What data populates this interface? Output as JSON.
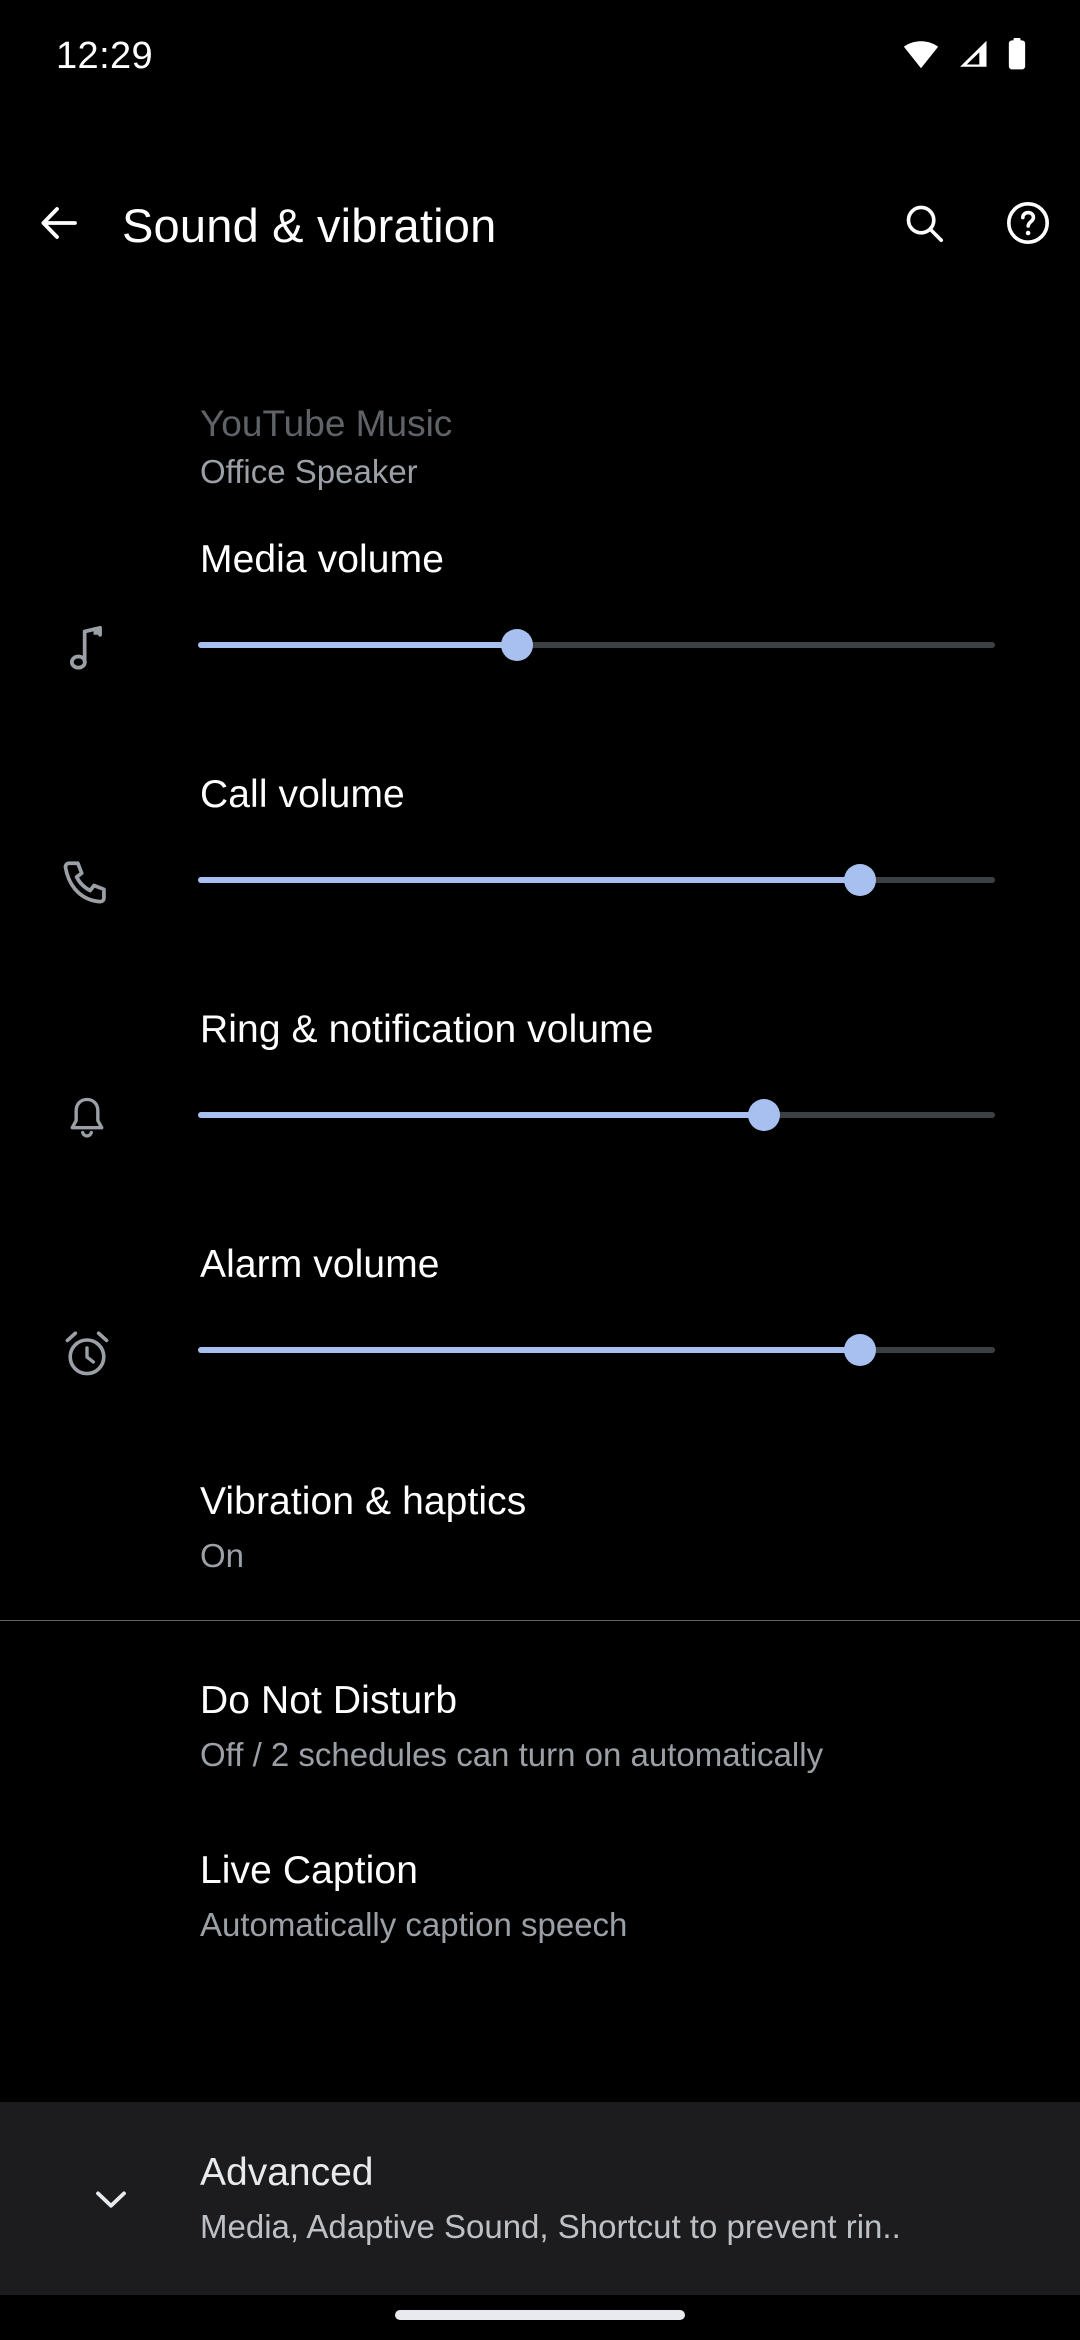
{
  "status_bar": {
    "clock": "12:29",
    "icons": [
      "wifi-icon",
      "cellular-signal-icon",
      "battery-icon"
    ]
  },
  "app_bar": {
    "back_icon": "back-arrow-icon",
    "title": "Sound & vibration",
    "search_icon": "search-icon",
    "help_icon": "help-icon"
  },
  "media_output": {
    "app": "YouTube Music",
    "device": "Office Speaker"
  },
  "volume_sliders": [
    {
      "label": "Media volume",
      "icon": "music-note-icon",
      "percent": 40
    },
    {
      "label": "Call volume",
      "icon": "phone-icon",
      "percent": 83
    },
    {
      "label": "Ring & notification volume",
      "icon": "bell-icon",
      "percent": 71
    },
    {
      "label": "Alarm volume",
      "icon": "alarm-clock-icon",
      "percent": 83
    }
  ],
  "settings_rows": [
    {
      "title": "Vibration & haptics",
      "subtitle": "On"
    },
    {
      "title": "Do Not Disturb",
      "subtitle": "Off / 2 schedules can turn on automatically"
    },
    {
      "title": "Live Caption",
      "subtitle": "Automatically caption speech"
    }
  ],
  "advanced": {
    "chevron_icon": "chevron-down-icon",
    "title": "Advanced",
    "subtitle": "Media, Adaptive Sound, Shortcut to prevent rin.."
  },
  "colors": {
    "background": "#000000",
    "slider_active": "#a8c0f0",
    "slider_inactive": "#3c4043",
    "primary_text": "#ffffff",
    "secondary_text": "#9aa0a6",
    "advanced_panel": "#1c1c1e"
  }
}
